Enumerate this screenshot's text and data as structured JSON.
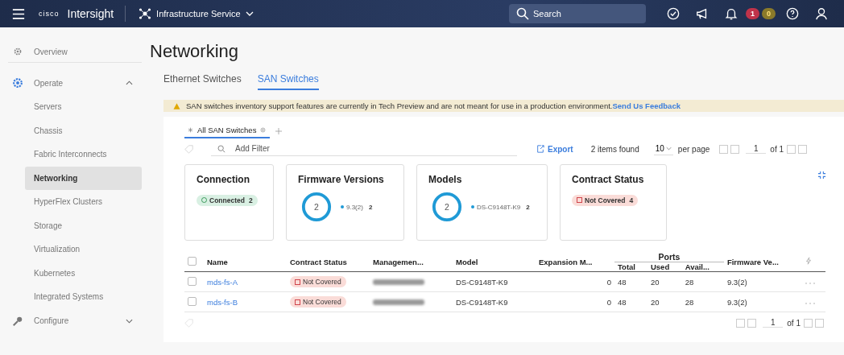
{
  "header": {
    "brand": "cisco",
    "product": "Intersight",
    "service": "Infrastructure Service",
    "search": {
      "placeholder": "Search"
    },
    "alerts": [
      {
        "kind": "error",
        "count": "1"
      },
      {
        "kind": "warning",
        "count": "0"
      }
    ]
  },
  "sidebar": {
    "items": [
      {
        "label": "Overview",
        "kind": "overview"
      },
      {
        "label": "Operate",
        "kind": "operate",
        "expanded": true,
        "children": [
          {
            "label": "Servers",
            "selected": false
          },
          {
            "label": "Chassis",
            "selected": false
          },
          {
            "label": "Fabric Interconnects",
            "selected": false
          },
          {
            "label": "Networking",
            "selected": true
          },
          {
            "label": "HyperFlex Clusters",
            "selected": false
          },
          {
            "label": "Storage",
            "selected": false
          },
          {
            "label": "Virtualization",
            "selected": false
          },
          {
            "label": "Kubernetes",
            "selected": false
          },
          {
            "label": "Integrated Systems",
            "selected": false
          }
        ]
      },
      {
        "label": "Configure",
        "kind": "configure",
        "expanded": false
      }
    ]
  },
  "page": {
    "title": "Networking",
    "tabs": [
      {
        "label": "Ethernet Switches",
        "selected": false
      },
      {
        "label": "SAN Switches",
        "selected": true
      }
    ],
    "banner": {
      "text": "SAN switches inventory support features are currently in Tech Preview and are not meant for use in a production environment.",
      "link": "Send Us Feedback"
    }
  },
  "view_tabs": [
    {
      "label": "All SAN Switches",
      "selected": true
    }
  ],
  "toolbar": {
    "filter_placeholder": "Add Filter",
    "export": "Export",
    "items_found": "2 items found",
    "per_page_value": "10",
    "per_page_label": "per page",
    "page": "1",
    "of_pages": "of 1"
  },
  "summary_cards": [
    {
      "title": "Connection",
      "kind": "badge",
      "badges": [
        {
          "kind": "ok",
          "label": "Connected",
          "count": "2"
        }
      ]
    },
    {
      "title": "Firmware Versions",
      "kind": "donut",
      "total": "2",
      "legend": [
        {
          "label": "9.3(2)",
          "count": "2"
        }
      ]
    },
    {
      "title": "Models",
      "kind": "donut",
      "total": "2",
      "legend": [
        {
          "label": "DS-C9148T-K9",
          "count": "2"
        }
      ]
    },
    {
      "title": "Contract Status",
      "kind": "badge",
      "badges": [
        {
          "kind": "error",
          "label": "Not Covered",
          "count": "4"
        }
      ]
    }
  ],
  "table": {
    "select_all_checked": false,
    "columns": [
      "Name",
      "Contract Status",
      "Managemen...",
      "Model",
      "Expansion M...",
      "Firmware Ve..."
    ],
    "ports_group": "Ports",
    "ports_columns": [
      "Total",
      "Used",
      "Avail..."
    ],
    "rows": [
      {
        "checked": false,
        "name": "mds-fs-A",
        "contract_status": "Not Covered",
        "model": "DS-C9148T-K9",
        "expansion": "0",
        "total": "48",
        "used": "20",
        "available": "28",
        "firmware": "9.3(2)"
      },
      {
        "checked": false,
        "name": "mds-fs-B",
        "contract_status": "Not Covered",
        "model": "DS-C9148T-K9",
        "expansion": "0",
        "total": "48",
        "used": "20",
        "available": "28",
        "firmware": "9.3(2)"
      }
    ]
  },
  "footer": {
    "page": "1",
    "of_pages": "of 1"
  }
}
